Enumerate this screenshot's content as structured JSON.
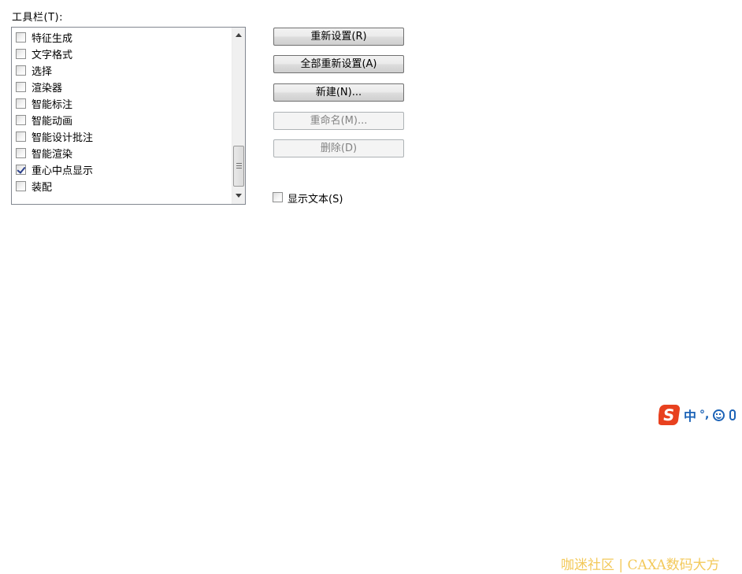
{
  "toolbar_label": "工具栏(T):",
  "toolbar_items": [
    {
      "label": "特征生成",
      "checked": false
    },
    {
      "label": "文字格式",
      "checked": false
    },
    {
      "label": "选择",
      "checked": false
    },
    {
      "label": "渲染器",
      "checked": false
    },
    {
      "label": "智能标注",
      "checked": false
    },
    {
      "label": "智能动画",
      "checked": false
    },
    {
      "label": "智能设计批注",
      "checked": false
    },
    {
      "label": "智能渲染",
      "checked": false
    },
    {
      "label": "重心中点显示",
      "checked": true
    },
    {
      "label": "装配",
      "checked": false
    }
  ],
  "buttons": {
    "reset": "重新设置(R)",
    "reset_all": "全部重新设置(A)",
    "new": "新建(N)...",
    "rename": "重命名(M)...",
    "delete": "删除(D)"
  },
  "show_text": {
    "label": "显示文本(S)",
    "checked": false
  },
  "ime_bar": {
    "logo": "S",
    "lang": "中",
    "punct": "°,"
  },
  "watermark": "咖迷社区 | CAXA数码大方",
  "colors": {
    "ime_brand": "#e8411f",
    "ime_icons": "#1c63b7",
    "watermark": "#f3c95a"
  }
}
